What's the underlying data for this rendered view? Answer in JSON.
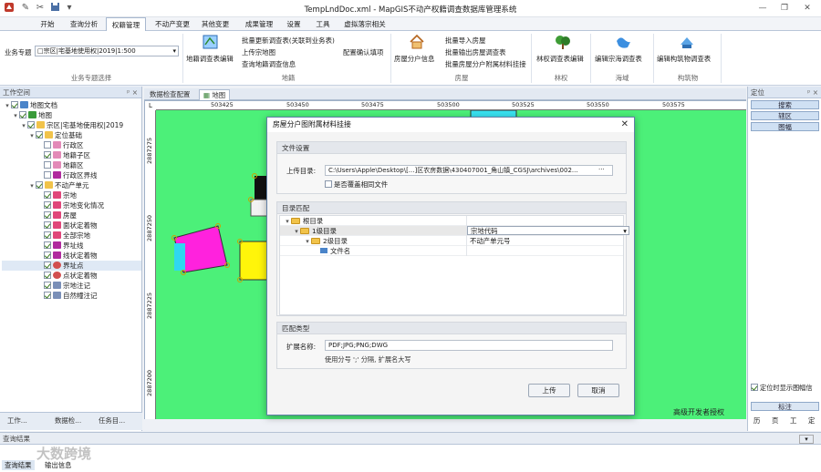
{
  "window": {
    "title": "TempLndDoc.xml - MapGIS不动产权籍调查数据库管理系统",
    "controls": [
      "minimize-icon",
      "restore-icon",
      "close-icon"
    ]
  },
  "menu_tabs": [
    "开始",
    "查询分析",
    "权籍管理",
    "不动产变更",
    "其他变更",
    "成果管理",
    "设置",
    "工具",
    "虚拟落宗相关"
  ],
  "active_tab": "权籍管理",
  "ribbon": {
    "business_label": "业务专题",
    "business_value": "□宗区|宅基地使用权|2019|1:500",
    "group_business": "业务专题选择",
    "group_land": "地籍",
    "group_house": "房屋",
    "group_forest": "林权",
    "group_sea": "海域",
    "group_structure": "构筑物",
    "land_survey_edit": "地籍调查表编辑",
    "batch_update_survey": "批量更新调查表(关联到业务表)",
    "upload_parcel_map": "上传宗地图",
    "query_land_survey": "查询地籍调查信息",
    "config_required_items": "配置确认填项",
    "house_household_info": "房屋分户信息",
    "batch_import_house": "批量导入房屋",
    "batch_export_house_survey": "批量输出房屋调查表",
    "batch_house_attach": "批量房屋分户附属材料挂接",
    "forest_survey_edit": "林权调查表编辑",
    "sea_survey_edit": "编辑宗海调查表",
    "structure_survey_edit": "编辑构筑物调查表"
  },
  "left_panel": {
    "title": "工作空间",
    "tree": [
      {
        "label": "地图文档",
        "level": 0,
        "checked": true,
        "icon": "document-icon"
      },
      {
        "label": "地图",
        "level": 1,
        "checked": true,
        "icon": "map-icon"
      },
      {
        "label": "宗区|宅基地使用权|2019",
        "level": 2,
        "checked": true,
        "icon": "folder-icon"
      },
      {
        "label": "定位基础",
        "level": 3,
        "checked": true,
        "icon": "folder-icon"
      },
      {
        "label": "行政区",
        "level": 4,
        "checked": false,
        "icon": "region-icon"
      },
      {
        "label": "地籍子区",
        "level": 4,
        "checked": true,
        "icon": "region-icon"
      },
      {
        "label": "地籍区",
        "level": 4,
        "checked": false,
        "icon": "region-icon"
      },
      {
        "label": "行政区界线",
        "level": 4,
        "checked": false,
        "icon": "line-icon"
      },
      {
        "label": "不动产单元",
        "level": 3,
        "checked": true,
        "icon": "folder-icon"
      },
      {
        "label": "宗地",
        "level": 4,
        "checked": true,
        "icon": "polygon-icon"
      },
      {
        "label": "宗地变化情况",
        "level": 4,
        "checked": true,
        "icon": "polygon-icon"
      },
      {
        "label": "房屋",
        "level": 4,
        "checked": true,
        "icon": "polygon-icon"
      },
      {
        "label": "面状定着物",
        "level": 4,
        "checked": true,
        "icon": "polygon-icon"
      },
      {
        "label": "全部宗地",
        "level": 4,
        "checked": true,
        "icon": "polygon-icon"
      },
      {
        "label": "界址线",
        "level": 4,
        "checked": true,
        "icon": "line-icon"
      },
      {
        "label": "线状定着物",
        "level": 4,
        "checked": true,
        "icon": "line-icon"
      },
      {
        "label": "界址点",
        "level": 4,
        "checked": true,
        "icon": "point-icon"
      },
      {
        "label": "点状定着物",
        "level": 4,
        "checked": true,
        "icon": "point-icon"
      },
      {
        "label": "宗地注记",
        "level": 4,
        "checked": true,
        "icon": "note-icon"
      },
      {
        "label": "自然幢注记",
        "level": 4,
        "checked": true,
        "icon": "note-icon"
      }
    ],
    "bottom_tabs": [
      "工作...",
      "数据检...",
      "任务目..."
    ]
  },
  "doc_tabs": [
    "数据检查配置",
    "地图"
  ],
  "map": {
    "ruler_top": [
      "503425",
      "503450",
      "503475",
      "503500",
      "503525",
      "503550",
      "503575"
    ],
    "ruler_left": [
      "2887275",
      "2887250",
      "2887225",
      "2887200"
    ],
    "watermark": "高级开发者授权",
    "map_color": "#4cf079"
  },
  "right_panel": {
    "title": "定位",
    "buttons": [
      "搜索",
      "辖区",
      "图幅"
    ],
    "checkbox": "定位时显示图幅信",
    "tab_label": "标注",
    "bottom_items": [
      "历",
      "页",
      "工",
      "定"
    ]
  },
  "status_panel": {
    "title": "查询结果",
    "tabs": [
      "查询结果",
      "输出信息"
    ],
    "watermark": "大数跨境"
  },
  "dialog": {
    "title": "房屋分户图附属材料挂接",
    "file_section": "文件设置",
    "upload_dir_label": "上传目录:",
    "upload_dir_value": "C:\\Users\\Apple\\Desktop\\[...]区农房数据\\430407001_角山镇_CGSJ\\archives\\002...",
    "overwrite_label": "是否覆盖相同文件",
    "overwrite_checked": false,
    "dir_section": "目录匹配",
    "dir_tree": [
      {
        "label": "根目录",
        "value": "",
        "level": 0
      },
      {
        "label": "1级目录",
        "value": "宗地代码",
        "level": 1
      },
      {
        "label": "2级目录",
        "value": "不动产单元号",
        "level": 2
      },
      {
        "label": "文件名",
        "value": "",
        "level": 3
      }
    ],
    "match_section": "匹配类型",
    "ext_label": "扩展名称:",
    "ext_value": "PDF;JPG;PNG;DWG",
    "ext_hint": "使用分号 ';' 分隔, 扩展名大写",
    "upload_button": "上传",
    "cancel_button": "取消"
  }
}
